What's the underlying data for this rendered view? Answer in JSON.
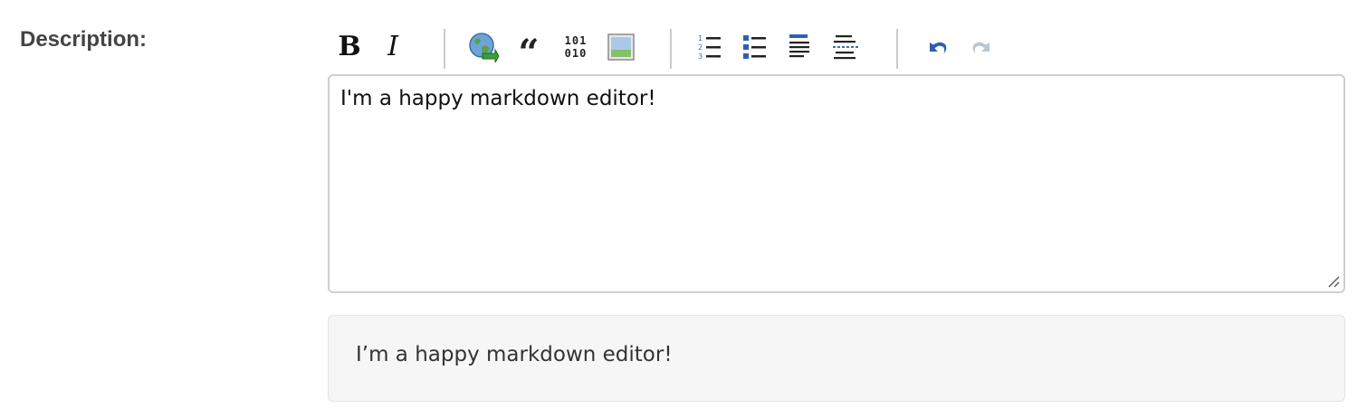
{
  "form": {
    "label": "Description:"
  },
  "toolbar": {
    "buttons": [
      {
        "name": "bold",
        "glyph": "B",
        "icon": "bold-icon"
      },
      {
        "name": "italic",
        "glyph": "I",
        "icon": "italic-icon"
      },
      {
        "name": "link",
        "icon": "globe-link-icon"
      },
      {
        "name": "blockquote",
        "glyph": "“",
        "icon": "quote-icon"
      },
      {
        "name": "code",
        "glyph_top": "101",
        "glyph_bottom": "010",
        "icon": "code-icon"
      },
      {
        "name": "image",
        "icon": "image-icon"
      },
      {
        "name": "ordered-list",
        "icon": "ordered-list-icon"
      },
      {
        "name": "unordered-list",
        "icon": "bulleted-list-icon"
      },
      {
        "name": "heading",
        "icon": "heading-icon"
      },
      {
        "name": "horizontal-rule",
        "icon": "horizontal-rule-icon"
      },
      {
        "name": "undo",
        "icon": "undo-icon"
      },
      {
        "name": "redo",
        "icon": "redo-icon",
        "disabled": true
      }
    ],
    "colors": {
      "accent": "#3a6fc4",
      "separator": "#cccccc",
      "disabled": "#b9c6d8"
    }
  },
  "editor": {
    "value": "I'm a happy markdown editor!"
  },
  "preview": {
    "text": "I’m a happy markdown editor!"
  }
}
